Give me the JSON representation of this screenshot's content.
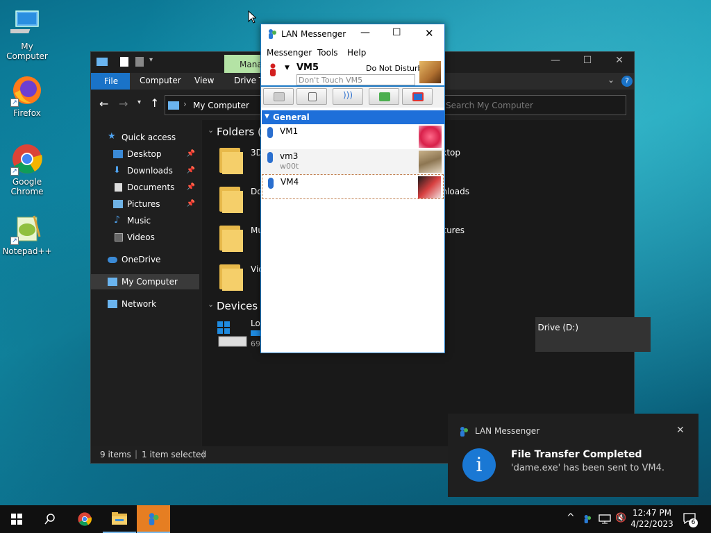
{
  "desktop": {
    "icons": [
      {
        "label": "My Computer"
      },
      {
        "label": "Firefox"
      },
      {
        "label": "Google Chrome"
      },
      {
        "label": "Notepad++"
      }
    ]
  },
  "explorer": {
    "manage_tab": "Manage",
    "ribbon_tabs": [
      "File",
      "Computer",
      "View",
      "Drive Tools"
    ],
    "address": "My Computer",
    "search_placeholder": "Search My Computer",
    "nav": {
      "quick_access": "Quick access",
      "items": [
        "Desktop",
        "Downloads",
        "Documents",
        "Pictures",
        "Music",
        "Videos"
      ],
      "onedrive": "OneDrive",
      "my_computer": "My Computer",
      "network": "Network"
    },
    "sections": {
      "folders": "Folders (7)",
      "devices": "Devices and drives (2)"
    },
    "folders_visible": [
      "3D Objects",
      "Desktop",
      "Documents",
      "Downloads",
      "Music",
      "Pictures",
      "Videos"
    ],
    "drives": {
      "local_label": "Local Disk (C:)",
      "local_free": "69.",
      "dvd_label": "DVD Drive (D:)"
    },
    "status": {
      "items": "9 items",
      "selected": "1 item selected"
    }
  },
  "lan_messenger": {
    "title": "LAN Messenger",
    "menu": [
      "Messenger",
      "Tools",
      "Help"
    ],
    "user": {
      "name": "VM5",
      "status": "Do Not Disturb",
      "note_placeholder": "Don't Touch VM5"
    },
    "toolbar_icons": [
      "chat-icon",
      "file-transfer-icon",
      "broadcast-icon",
      "add-contact-icon",
      "settings-icon"
    ],
    "group": "General",
    "contacts": [
      {
        "name": "VM1",
        "note": ""
      },
      {
        "name": "vm3",
        "note": "w00t"
      },
      {
        "name": "VM4",
        "note": ""
      }
    ]
  },
  "notification": {
    "app": "LAN Messenger",
    "title": "File Transfer Completed",
    "message": "'dame.exe' has been sent to VM4."
  },
  "taskbar": {
    "time": "12:47 PM",
    "date": "4/22/2023",
    "notification_count": "6"
  },
  "colors": {
    "accent": "#1a73c8",
    "lan_group": "#1e6fd9",
    "toast_info": "#1a78d4"
  }
}
